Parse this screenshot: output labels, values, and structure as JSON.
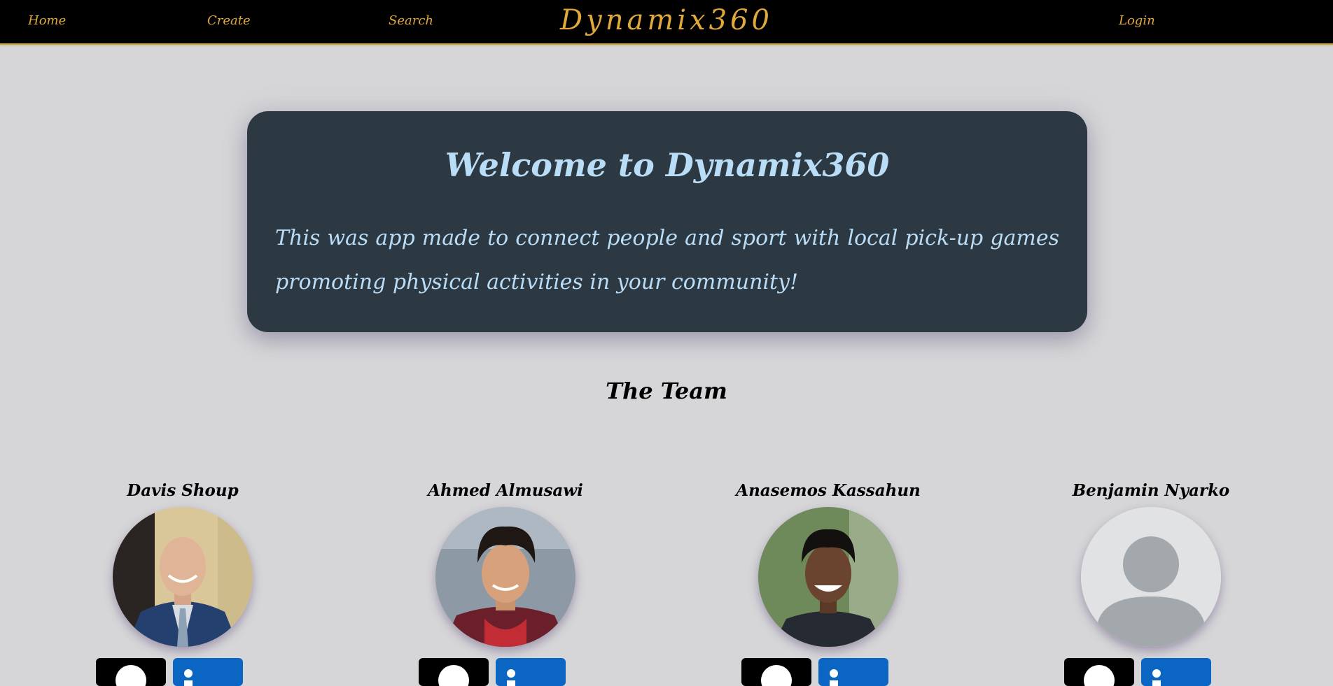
{
  "nav": {
    "home": "Home",
    "create": "Create",
    "search": "Search",
    "brand": "Dynamix360",
    "login": "Login"
  },
  "hero": {
    "title": "Welcome to Dynamix360",
    "text": "This was app made to connect people and sport with local pick-up games promoting physical activities in your community!"
  },
  "team": {
    "title": "The Team",
    "members": [
      {
        "name": "Davis Shoup",
        "avatar": "photo-man-in-suit"
      },
      {
        "name": "Ahmed Almusawi",
        "avatar": "photo-man-curly-hair"
      },
      {
        "name": "Anasemos Kassahun",
        "avatar": "photo-man-smiling"
      },
      {
        "name": "Benjamin Nyarko",
        "avatar": "default-user-icon"
      }
    ]
  },
  "icons": {
    "github": "github-icon",
    "linkedin": "linkedin-icon"
  },
  "colors": {
    "nav_bg": "#000000",
    "nav_text": "#e0a93a",
    "hero_bg": "#2c3842",
    "hero_text": "#b9dcf7",
    "page_bg": "#d6d6d8",
    "linkedin": "#0a66c2"
  }
}
